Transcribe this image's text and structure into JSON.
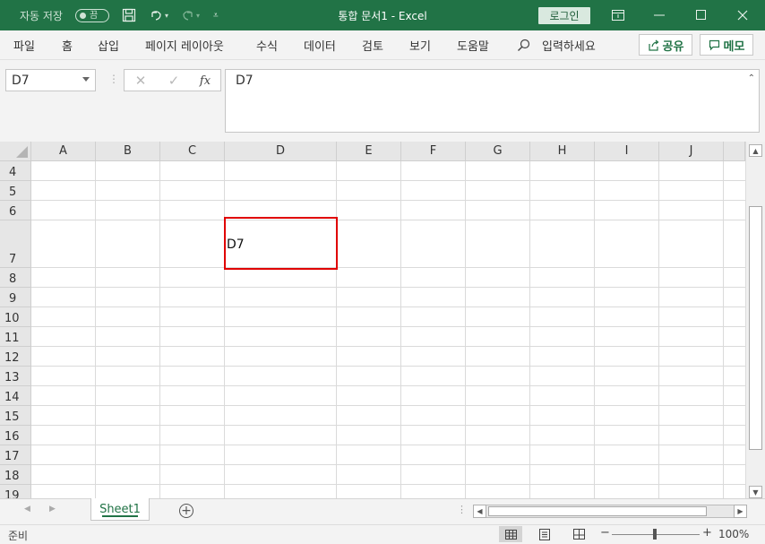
{
  "titlebar": {
    "autosave_label": "자동 저장",
    "autosave_toggle": "끔",
    "title": "통합 문서1  -  Excel",
    "login": "로그인",
    "bg_color": "#217346"
  },
  "ribbon": {
    "tabs": [
      "파일",
      "홈",
      "삽입",
      "페이지 레이아웃",
      "수식",
      "데이터",
      "검토",
      "보기",
      "도움말"
    ],
    "search": "입력하세요",
    "share": "공유",
    "memo": "메모"
  },
  "formula_bar": {
    "name_box": "D7",
    "formula_value": "D7",
    "fx_label": "fx"
  },
  "grid": {
    "columns": [
      "A",
      "B",
      "C",
      "D",
      "E",
      "F",
      "G",
      "H",
      "I",
      "J"
    ],
    "rows": [
      "4",
      "5",
      "6",
      "7",
      "8",
      "9",
      "10",
      "11",
      "12",
      "13",
      "14",
      "15",
      "16",
      "17",
      "18",
      "19"
    ],
    "selected_cell": "D7",
    "cell_d7_value": "D7",
    "selection_color": "#e00000"
  },
  "sheets": {
    "tabs": [
      "Sheet1"
    ],
    "active": "Sheet1"
  },
  "status": {
    "ready": "준비",
    "zoom": "100%"
  }
}
